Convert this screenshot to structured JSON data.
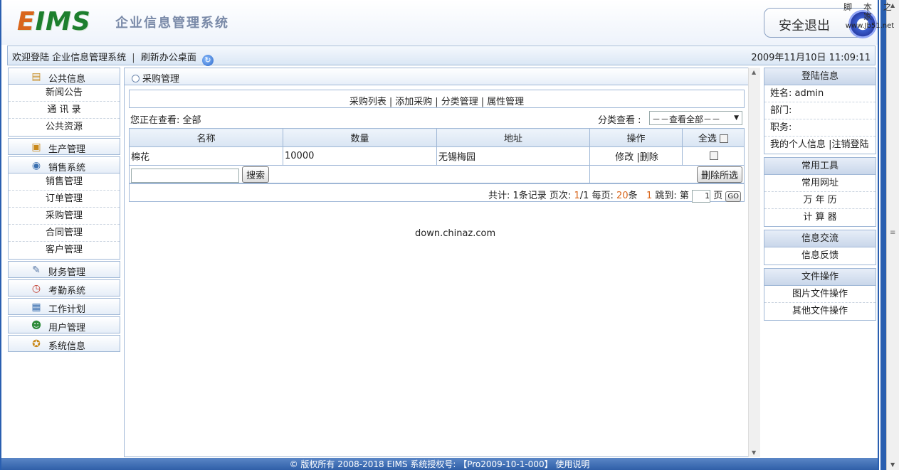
{
  "header": {
    "logo": "EIMS",
    "system_title": "企业信息管理系统",
    "logout_label": "安全退出",
    "watermark_line1": "脚 本 之 家",
    "watermark_line2": "www.Jb51.net"
  },
  "welcome_bar": {
    "welcome": "欢迎登陆 企业信息管理系统",
    "separator": "|",
    "refresh": "刷新办公桌面",
    "datetime": "2009年11月10日 11:09:11"
  },
  "sidebar": {
    "public_info": {
      "label": "公共信息",
      "items": [
        "新闻公告",
        "通 讯 录",
        "公共资源"
      ]
    },
    "production": {
      "label": "生产管理"
    },
    "sales": {
      "label": "销售系统",
      "items": [
        "销售管理",
        "订单管理",
        "采购管理",
        "合同管理",
        "客户管理"
      ]
    },
    "finance": {
      "label": "财务管理"
    },
    "attendance": {
      "label": "考勤系统"
    },
    "work_plan": {
      "label": "工作计划"
    },
    "users": {
      "label": "用户管理"
    },
    "system_info": {
      "label": "系统信息"
    }
  },
  "main": {
    "title": "采购管理",
    "tabs": [
      "采购列表",
      "添加采购",
      "分类管理",
      "属性管理"
    ],
    "viewing_label": "您正在查看: 全部",
    "category_label": "分类查看 :",
    "category_selected": "－－查看全部－－",
    "table": {
      "headers": [
        "名称",
        "数量",
        "地址",
        "操作",
        "全选"
      ],
      "rows": [
        {
          "name": "棉花",
          "qty": "10000",
          "addr": "无锡梅园",
          "edit": "修改",
          "delete": "删除"
        }
      ]
    },
    "search_button": "搜索",
    "delete_selected": "删除所选",
    "pager": {
      "total_prefix": "共计: ",
      "total_count": "1",
      "total_suffix": "条记录 页次: ",
      "page_current": "1",
      "page_total": "/1",
      "per_page_label": " 每页: ",
      "per_page": "20",
      "per_page_unit": "条 ",
      "page_link": "1",
      "jump_label": " 跳到: 第",
      "jump_value": "1",
      "page_unit": "页",
      "go": "GO"
    },
    "watermark": "down.chinaz.com"
  },
  "right": {
    "login": {
      "title": "登陆信息",
      "name": "姓名: admin",
      "dept": "部门:",
      "job": "职务:",
      "my_info": "我的个人信息",
      "logout": "注销登陆"
    },
    "tools": {
      "title": "常用工具",
      "items": [
        "常用网址",
        "万 年 历",
        "计 算 器"
      ]
    },
    "exchange": {
      "title": "信息交流",
      "items": [
        "信息反馈"
      ]
    },
    "files": {
      "title": "文件操作",
      "items": [
        "图片文件操作",
        "其他文件操作"
      ]
    }
  },
  "footer": {
    "text": "© 版权所有 2008-2018 EIMS 系统授权号: 【Pro2009-10-1-000】 使用说明"
  }
}
